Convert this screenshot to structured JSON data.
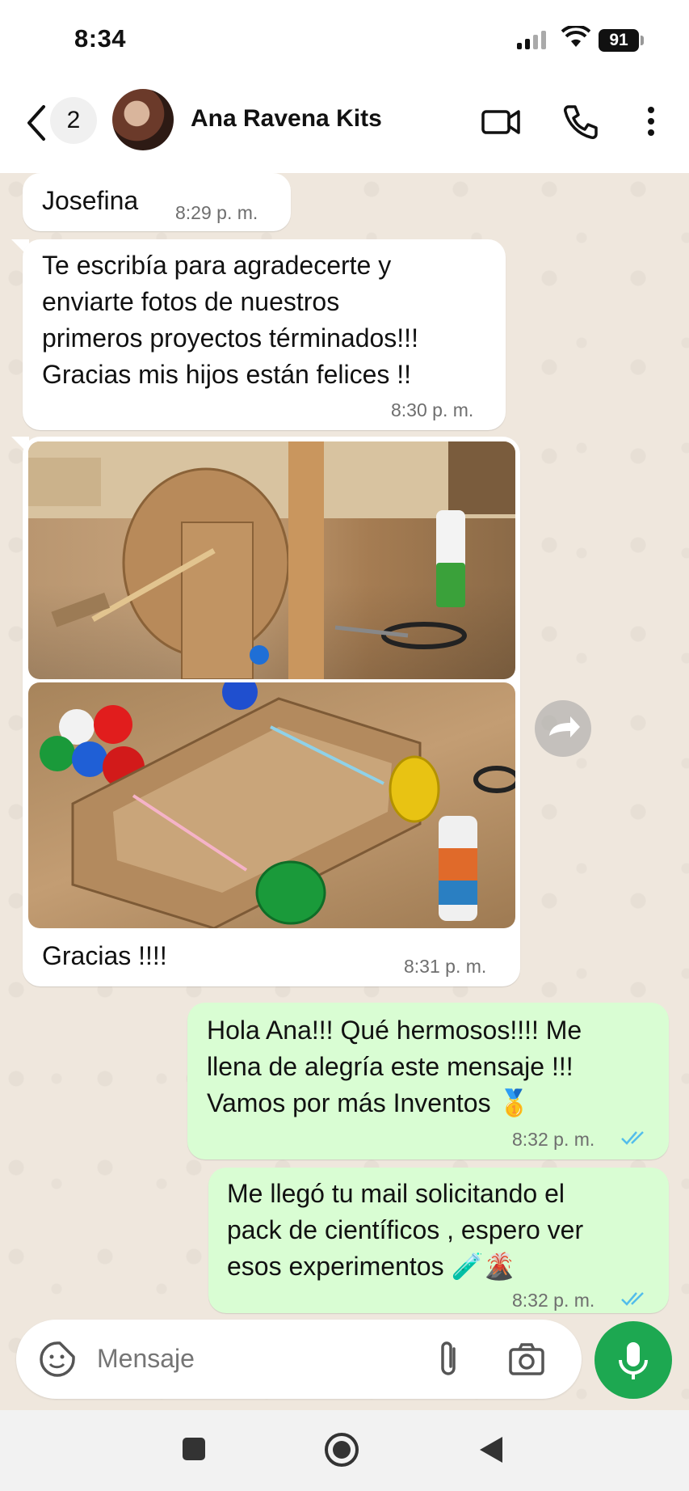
{
  "status_bar": {
    "time": "8:34",
    "battery": "91"
  },
  "header": {
    "unread_count": "2",
    "contact_name": "Ana Ravena Kits"
  },
  "messages": [
    {
      "direction": "in",
      "text": "Josefina",
      "time": "8:29 p. m."
    },
    {
      "direction": "in",
      "text": "Te escribía para agradecerte y\nenviarte fotos de nuestros\nprimeros  proyectos términados!!!\nGracias mis hijos están felices !!",
      "time": "8:30 p. m."
    },
    {
      "direction": "in",
      "type": "photo",
      "caption": "Gracias !!!!",
      "time": "8:31 p. m."
    },
    {
      "direction": "out",
      "text": "Hola Ana!!! Qué hermosos!!!! Me\nllena de alegría este mensaje !!!\nVamos por más Inventos 🥇",
      "time": "8:32 p. m.",
      "status": "read"
    },
    {
      "direction": "out",
      "text": "Me llegó tu mail  solicitando el\npack de científicos , espero ver\nesos experimentos 🧪🌋",
      "time": "8:32 p. m.",
      "status": "read"
    }
  ],
  "input": {
    "placeholder": "Mensaje"
  },
  "colors": {
    "accent": "#1da851",
    "outgoing_bubble": "#d9fdd3",
    "read_ticks": "#53bdeb",
    "chat_background": "#efe7dd"
  }
}
